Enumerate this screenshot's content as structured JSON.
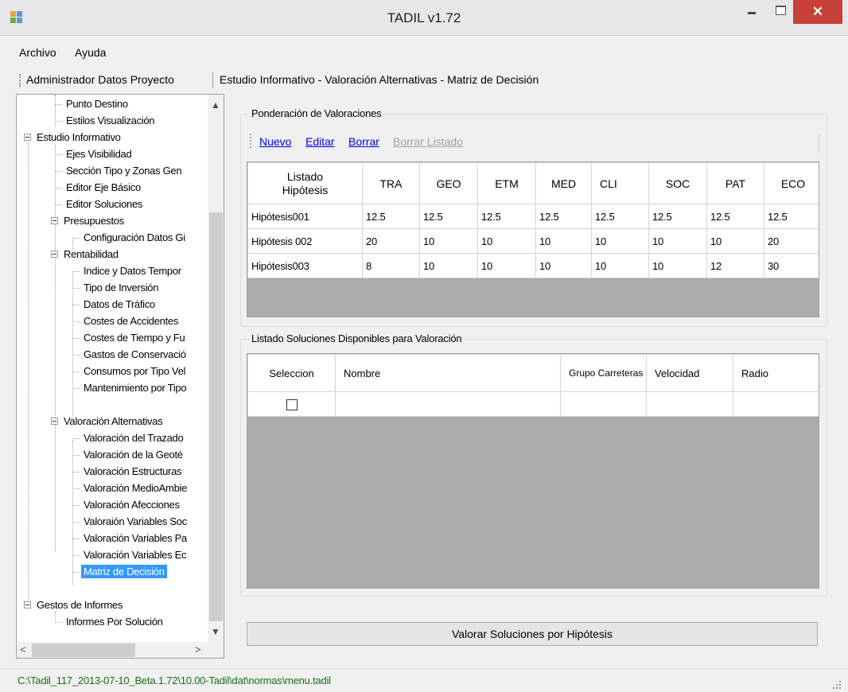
{
  "window": {
    "title": "TADIL v1.72",
    "close_glyph": "✕"
  },
  "menu": {
    "items": [
      {
        "label": "Archivo"
      },
      {
        "label": "Ayuda"
      }
    ]
  },
  "breadcrumb": {
    "items": [
      {
        "label": "Administrador Datos Proyecto"
      },
      {
        "label": "Estudio Informativo - Valoración Alternativas - Matriz de Decisión"
      }
    ]
  },
  "tree": {
    "items": [
      {
        "label": "Punto Destino"
      },
      {
        "label": "Estilos Visualización"
      },
      {
        "label": "Estudio Informativo"
      },
      {
        "label": "Ejes Visibilidad"
      },
      {
        "label": "Sección Tipo y Zonas Gen"
      },
      {
        "label": "Editor Eje Básico"
      },
      {
        "label": "Editor Soluciones"
      },
      {
        "label": "Presupuestos"
      },
      {
        "label": "Configuración Datos Gi"
      },
      {
        "label": "Rentabilidad"
      },
      {
        "label": "Indice y Datos Tempor"
      },
      {
        "label": "Tipo de Inversión"
      },
      {
        "label": "Datos de Tráfico"
      },
      {
        "label": "Costes de Accidentes"
      },
      {
        "label": "Costes de Tiempo y Fu"
      },
      {
        "label": "Gastos de Conservació"
      },
      {
        "label": "Consumos por Tipo Vel"
      },
      {
        "label": "Mantenimiento por Tipo"
      },
      {
        "label": "Valoración Alternativas"
      },
      {
        "label": "Valoración del Trazado"
      },
      {
        "label": "Valoración de la Geoté"
      },
      {
        "label": "Valoración Estructuras"
      },
      {
        "label": "Valoración MedioAmbie"
      },
      {
        "label": "Valoración Afecciones"
      },
      {
        "label": "Valoraión Variables Soc"
      },
      {
        "label": "Valoración Variables Pa"
      },
      {
        "label": "Valoración Variables Ec"
      },
      {
        "label": "Matriz de Decisión"
      },
      {
        "label": "Gestos de Informes"
      },
      {
        "label": "Informes Por Solución"
      }
    ],
    "scroll": {
      "up": "▲",
      "down": "▼",
      "left": "<",
      "right": ">"
    }
  },
  "ponderacion": {
    "group_title": "Ponderación de Valoraciones",
    "toolbar": {
      "nuevo": "Nuevo",
      "editar": "Editar",
      "borrar": "Borrar",
      "borrar_listado": "Borrar Listado"
    },
    "columns": [
      "Listado Hipótesis",
      "TRA",
      "GEO",
      "ETM",
      "MED",
      "CLI",
      "SOC",
      "PAT",
      "ECO"
    ],
    "rows": [
      [
        "Hipótesis001",
        "12.5",
        "12.5",
        "12.5",
        "12.5",
        "12.5",
        "12.5",
        "12.5",
        "12.5"
      ],
      [
        "Hipótesis 002",
        "20",
        "10",
        "10",
        "10",
        "10",
        "10",
        "10",
        "20"
      ],
      [
        "Hipótesis003",
        "8",
        "10",
        "10",
        "10",
        "10",
        "10",
        "12",
        "30"
      ]
    ]
  },
  "soluciones": {
    "group_title": "Listado Soluciones Disponibles para Valoración",
    "columns": {
      "seleccion": "Seleccion",
      "nombre": "Nombre",
      "grupo": "Grupo Carreteras",
      "velocidad": "Velocidad",
      "radio": "Radio"
    }
  },
  "action": {
    "label": "Valorar Soluciones por Hipótesis"
  },
  "status": {
    "path": "C:\\Tadil_117_2013-07-10_Beta.1.72\\10.00-Tadil\\dat\\normas\\menu.tadil"
  },
  "colors": {
    "selection": "#3399ff",
    "close_button": "#c7403a",
    "link": "#0000ee",
    "status_text": "#1a6d1a",
    "grid_background": "#ababab"
  }
}
